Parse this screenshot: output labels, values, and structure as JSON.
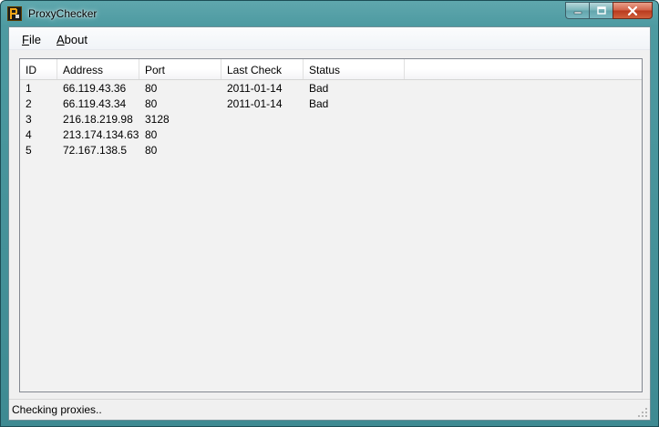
{
  "window": {
    "title": "ProxyChecker"
  },
  "menu": {
    "file_accel": "F",
    "file_rest": "ile",
    "about_accel": "A",
    "about_rest": "bout"
  },
  "table": {
    "columns": [
      "ID",
      "Address",
      "Port",
      "Last Check",
      "Status",
      ""
    ],
    "rows": [
      {
        "id": "1",
        "address": "66.119.43.36",
        "port": "80",
        "last_check": "2011-01-14",
        "status": "Bad"
      },
      {
        "id": "2",
        "address": "66.119.43.34",
        "port": "80",
        "last_check": "2011-01-14",
        "status": "Bad"
      },
      {
        "id": "3",
        "address": "216.18.219.98",
        "port": "3128",
        "last_check": "",
        "status": ""
      },
      {
        "id": "4",
        "address": "213.174.134.63",
        "port": "80",
        "last_check": "",
        "status": ""
      },
      {
        "id": "5",
        "address": "72.167.138.5",
        "port": "80",
        "last_check": "",
        "status": ""
      }
    ]
  },
  "status": {
    "text": "Checking proxies.."
  },
  "icons": {
    "app": "proxychecker-app-icon",
    "minimize": "minimize-icon",
    "maximize": "maximize-icon",
    "close": "close-icon",
    "grip": "resize-grip-icon"
  },
  "colors": {
    "frame": "#4d9aa1",
    "client": "#f0f0f0",
    "close_button": "#c8492a"
  }
}
